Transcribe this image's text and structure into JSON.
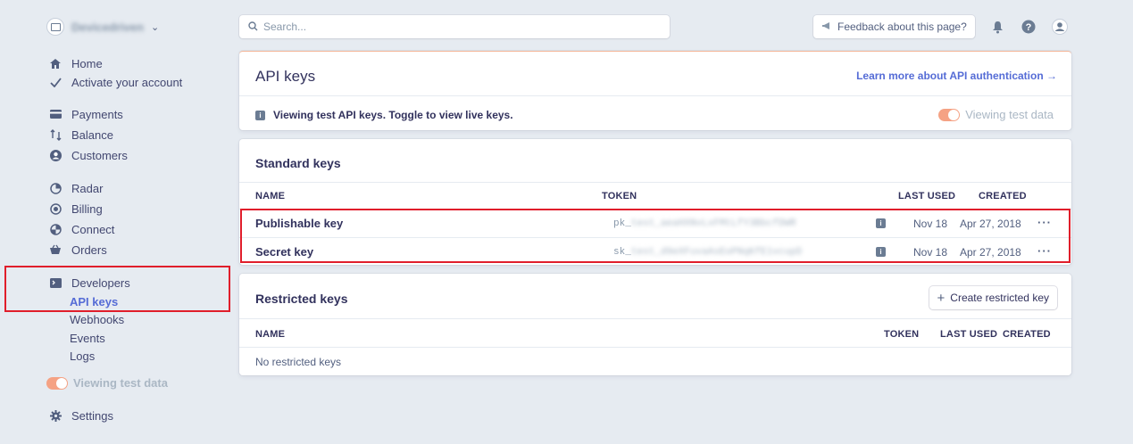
{
  "account": {
    "name": "Devicedriven"
  },
  "sidebar": {
    "items": [
      {
        "label": "Home"
      },
      {
        "label": "Activate your account"
      },
      {
        "label": "Payments"
      },
      {
        "label": "Balance"
      },
      {
        "label": "Customers"
      },
      {
        "label": "Radar"
      },
      {
        "label": "Billing"
      },
      {
        "label": "Connect"
      },
      {
        "label": "Orders"
      },
      {
        "label": "Developers"
      },
      {
        "label": "Settings"
      }
    ],
    "developer_sub": [
      "API keys",
      "Webhooks",
      "Events",
      "Logs"
    ],
    "test_toggle_label": "Viewing test data"
  },
  "topbar": {
    "search_placeholder": "Search...",
    "feedback_label": "Feedback about this page?"
  },
  "api_card": {
    "title": "API keys",
    "learn_more": "Learn more about API authentication →",
    "banner": "Viewing test API keys. Toggle to view live keys.",
    "toggle_label": "Viewing test data"
  },
  "standard_keys": {
    "title": "Standard keys",
    "columns": {
      "name": "NAME",
      "token": "TOKEN",
      "last_used": "LAST USED",
      "created": "CREATED"
    },
    "rows": [
      {
        "name": "Publishable key",
        "token_prefix": "pk_",
        "token_rest": "test_aeaHXNvLxFMtLfY3BbcfDWR",
        "last_used": "Nov 18",
        "created": "Apr 27, 2018",
        "more": "···"
      },
      {
        "name": "Secret key",
        "token_prefix": "sk_",
        "token_rest": "test_d9eXFuvaAsEoPNqKfE1vcupD",
        "last_used": "Nov 18",
        "created": "Apr 27, 2018",
        "more": "···"
      }
    ]
  },
  "restricted_keys": {
    "title": "Restricted keys",
    "create_button": "Create restricted key",
    "columns": {
      "name": "NAME",
      "token": "TOKEN",
      "last_used": "LAST USED",
      "created": "CREATED"
    },
    "empty": "No restricted keys"
  },
  "colors": {
    "accent": "#556cd6",
    "toggle": "#f5a284",
    "highlight": "#e01e2b",
    "background": "#e6ebf1"
  }
}
